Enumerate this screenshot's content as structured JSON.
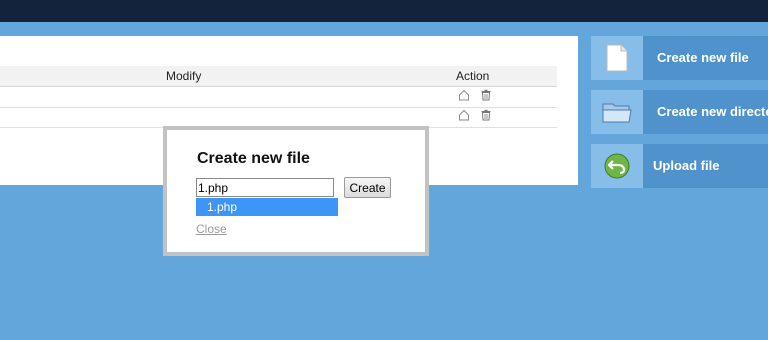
{
  "table": {
    "headers": {
      "modify": "Modify",
      "action": "Action"
    },
    "rows": [
      {
        "actions": [
          "home-icon",
          "trash-icon"
        ]
      },
      {
        "actions": [
          "home-icon",
          "trash-icon"
        ]
      }
    ]
  },
  "sidebar": {
    "buttons": [
      {
        "label": "Create new file",
        "icon": "file-icon"
      },
      {
        "label": "Create new directory",
        "icon": "folder-icon"
      },
      {
        "label": "Upload file",
        "icon": "upload-icon"
      }
    ]
  },
  "dialog": {
    "title": "Create new file",
    "input_value": "1.php",
    "submit_label": "Create",
    "suggestion": "1.php",
    "close_label": "Close"
  },
  "colors": {
    "background": "#63a6dc",
    "topbar": "#13233a",
    "sidebar_button": "#4f92cc",
    "sidebar_icon_bg": "#87bde9",
    "suggestion_highlight": "#3d96f5"
  }
}
